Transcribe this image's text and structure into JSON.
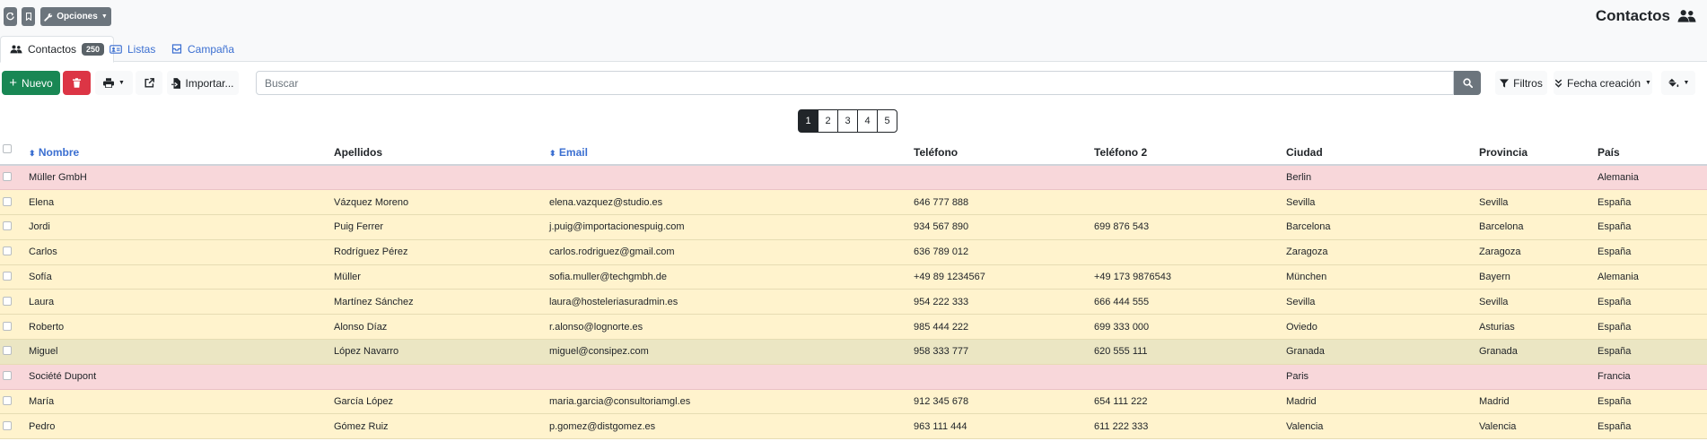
{
  "topbar": {
    "options_label": "Opciones",
    "page_title": "Contactos"
  },
  "tabs": [
    {
      "label": "Contactos",
      "badge": "250"
    },
    {
      "label": "Listas"
    },
    {
      "label": "Campaña"
    }
  ],
  "toolbar": {
    "new_label": "Nuevo",
    "import_label": "Importar...",
    "search_placeholder": "Buscar",
    "filters_label": "Filtros",
    "sort_label": "Fecha creación"
  },
  "pagination": [
    "1",
    "2",
    "3",
    "4",
    "5"
  ],
  "table": {
    "headers": [
      "Nombre",
      "Apellidos",
      "Email",
      "Teléfono",
      "Teléfono 2",
      "Ciudad",
      "Provincia",
      "País"
    ],
    "rows": [
      {
        "nombre": "Müller GmbH",
        "apellidos": "",
        "email": "",
        "telefono": "",
        "telefono2": "",
        "ciudad": "Berlin",
        "provincia": "",
        "pais": "Alemania"
      },
      {
        "nombre": "Elena",
        "apellidos": "Vázquez Moreno",
        "email": "elena.vazquez@studio.es",
        "telefono": "646 777 888",
        "telefono2": "",
        "ciudad": "Sevilla",
        "provincia": "Sevilla",
        "pais": "España"
      },
      {
        "nombre": "Jordi",
        "apellidos": "Puig Ferrer",
        "email": "j.puig@importacionespuig.com",
        "telefono": "934 567 890",
        "telefono2": "699 876 543",
        "ciudad": "Barcelona",
        "provincia": "Barcelona",
        "pais": "España"
      },
      {
        "nombre": "Carlos",
        "apellidos": "Rodríguez Pérez",
        "email": "carlos.rodriguez@gmail.com",
        "telefono": "636 789 012",
        "telefono2": "",
        "ciudad": "Zaragoza",
        "provincia": "Zaragoza",
        "pais": "España"
      },
      {
        "nombre": "Sofía",
        "apellidos": "Müller",
        "email": "sofia.muller@techgmbh.de",
        "telefono": "+49 89 1234567",
        "telefono2": "+49 173 9876543",
        "ciudad": "München",
        "provincia": "Bayern",
        "pais": "Alemania"
      },
      {
        "nombre": "Laura",
        "apellidos": "Martínez Sánchez",
        "email": "laura@hosteleriasuradmin.es",
        "telefono": "954 222 333",
        "telefono2": "666 444 555",
        "ciudad": "Sevilla",
        "provincia": "Sevilla",
        "pais": "España"
      },
      {
        "nombre": "Roberto",
        "apellidos": "Alonso Díaz",
        "email": "r.alonso@lognorte.es",
        "telefono": "985 444 222",
        "telefono2": "699 333 000",
        "ciudad": "Oviedo",
        "provincia": "Asturias",
        "pais": "España"
      },
      {
        "nombre": "Miguel",
        "apellidos": "López Navarro",
        "email": "miguel@consipez.com",
        "telefono": "958 333 777",
        "telefono2": "620 555 111",
        "ciudad": "Granada",
        "provincia": "Granada",
        "pais": "España"
      },
      {
        "nombre": "Société Dupont",
        "apellidos": "",
        "email": "",
        "telefono": "",
        "telefono2": "",
        "ciudad": "Paris",
        "provincia": "",
        "pais": "Francia"
      },
      {
        "nombre": "María",
        "apellidos": "García López",
        "email": "maria.garcia@consultoriamgl.es",
        "telefono": "912 345 678",
        "telefono2": "654 111 222",
        "ciudad": "Madrid",
        "provincia": "Madrid",
        "pais": "España"
      },
      {
        "nombre": "Pedro",
        "apellidos": "Gómez Ruiz",
        "email": "p.gomez@distgomez.es",
        "telefono": "963 111 444",
        "telefono2": "611 222 333",
        "ciudad": "Valencia",
        "provincia": "Valencia",
        "pais": "España"
      }
    ]
  },
  "colors": {
    "company_row": "#f8d7da",
    "person_row": "#fff3cd",
    "new_button": "#198754",
    "delete_button": "#dc3545",
    "link": "#3b6fd1"
  }
}
